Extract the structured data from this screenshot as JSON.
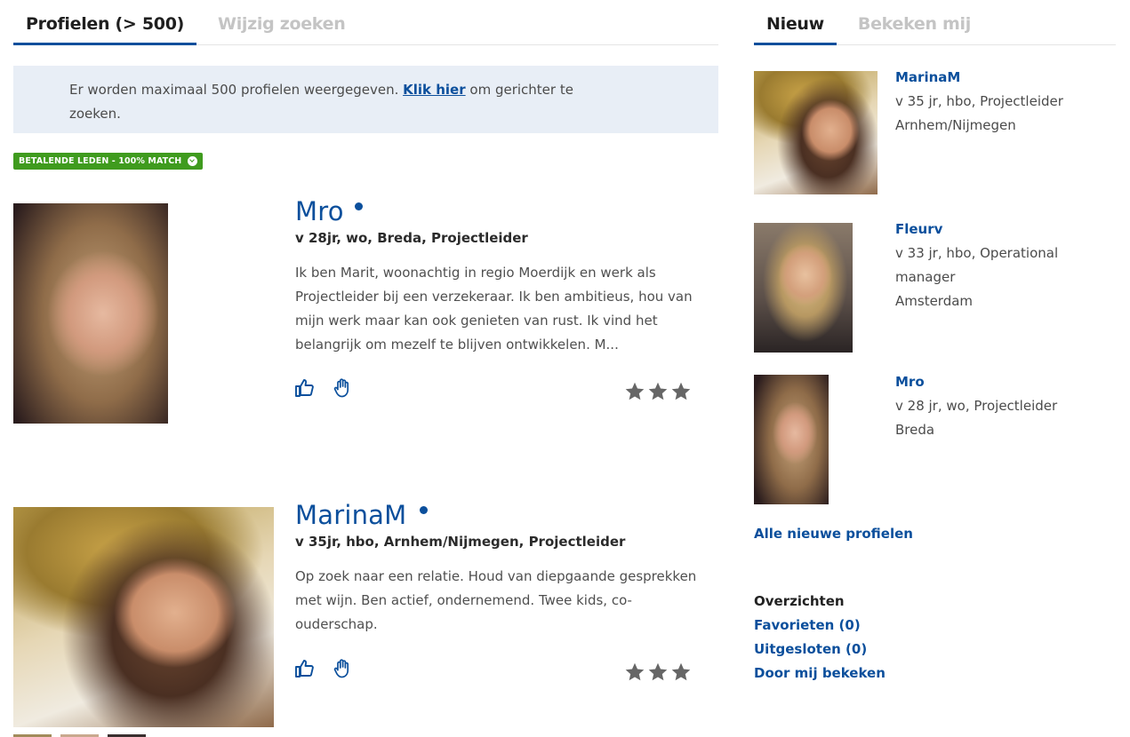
{
  "tabs_left": {
    "profiles": "Profielen (> 500)",
    "edit_search": "Wijzig zoeken"
  },
  "tabs_right": {
    "new": "Nieuw",
    "viewed_me": "Bekeken mij"
  },
  "banner": {
    "text_before": "Er worden maximaal 500 profielen weergegeven. ",
    "link": "Klik hier",
    "text_after": " om gerichter te zoeken."
  },
  "badge": {
    "label": "BETALENDE LEDEN - 100% MATCH",
    "icon": "arrow-down-circle-icon"
  },
  "profiles": [
    {
      "name": "Mro",
      "meta": "v 28jr, wo, Breda, Projectleider",
      "description": "Ik ben Marit, woonachtig in regio Moerdijk en werk als Projectleider bij een verzekeraar. Ik ben ambitieus, hou van mijn werk maar kan ook genieten van rust. Ik vind het belangrijk om mezelf te blijven ontwikkelen. M...",
      "stars": 3
    },
    {
      "name": "MarinaM",
      "meta": "v 35jr, hbo, Arnhem/Nijmegen, Projectleider",
      "description": "Op zoek naar een relatie. Houd van diepgaande gesprekken met wijn. Ben actief, ondernemend. Twee kids, co-ouderschap.",
      "stars": 3
    }
  ],
  "sidebar": {
    "new_profiles": [
      {
        "name": "MarinaM",
        "line1": "v 35 jr, hbo, Projectleider",
        "line2": "Arnhem/Nijmegen"
      },
      {
        "name": "Fleurv",
        "line1": "v 33 jr, hbo, Operational",
        "line1b": "manager",
        "line2": "Amsterdam"
      },
      {
        "name": "Mro",
        "line1": "v 28 jr, wo, Projectleider",
        "line2": "Breda"
      }
    ],
    "all_new_link": "Alle nieuwe profielen",
    "overviews_heading": "Overzichten",
    "favorites": "Favorieten (0)",
    "excluded": "Uitgesloten (0)",
    "viewed_by_me": "Door mij bekeken"
  },
  "colors": {
    "accent": "#0b4f9c",
    "badge": "#3f9b1e",
    "banner_bg": "#e8eef6",
    "star": "#666666"
  }
}
